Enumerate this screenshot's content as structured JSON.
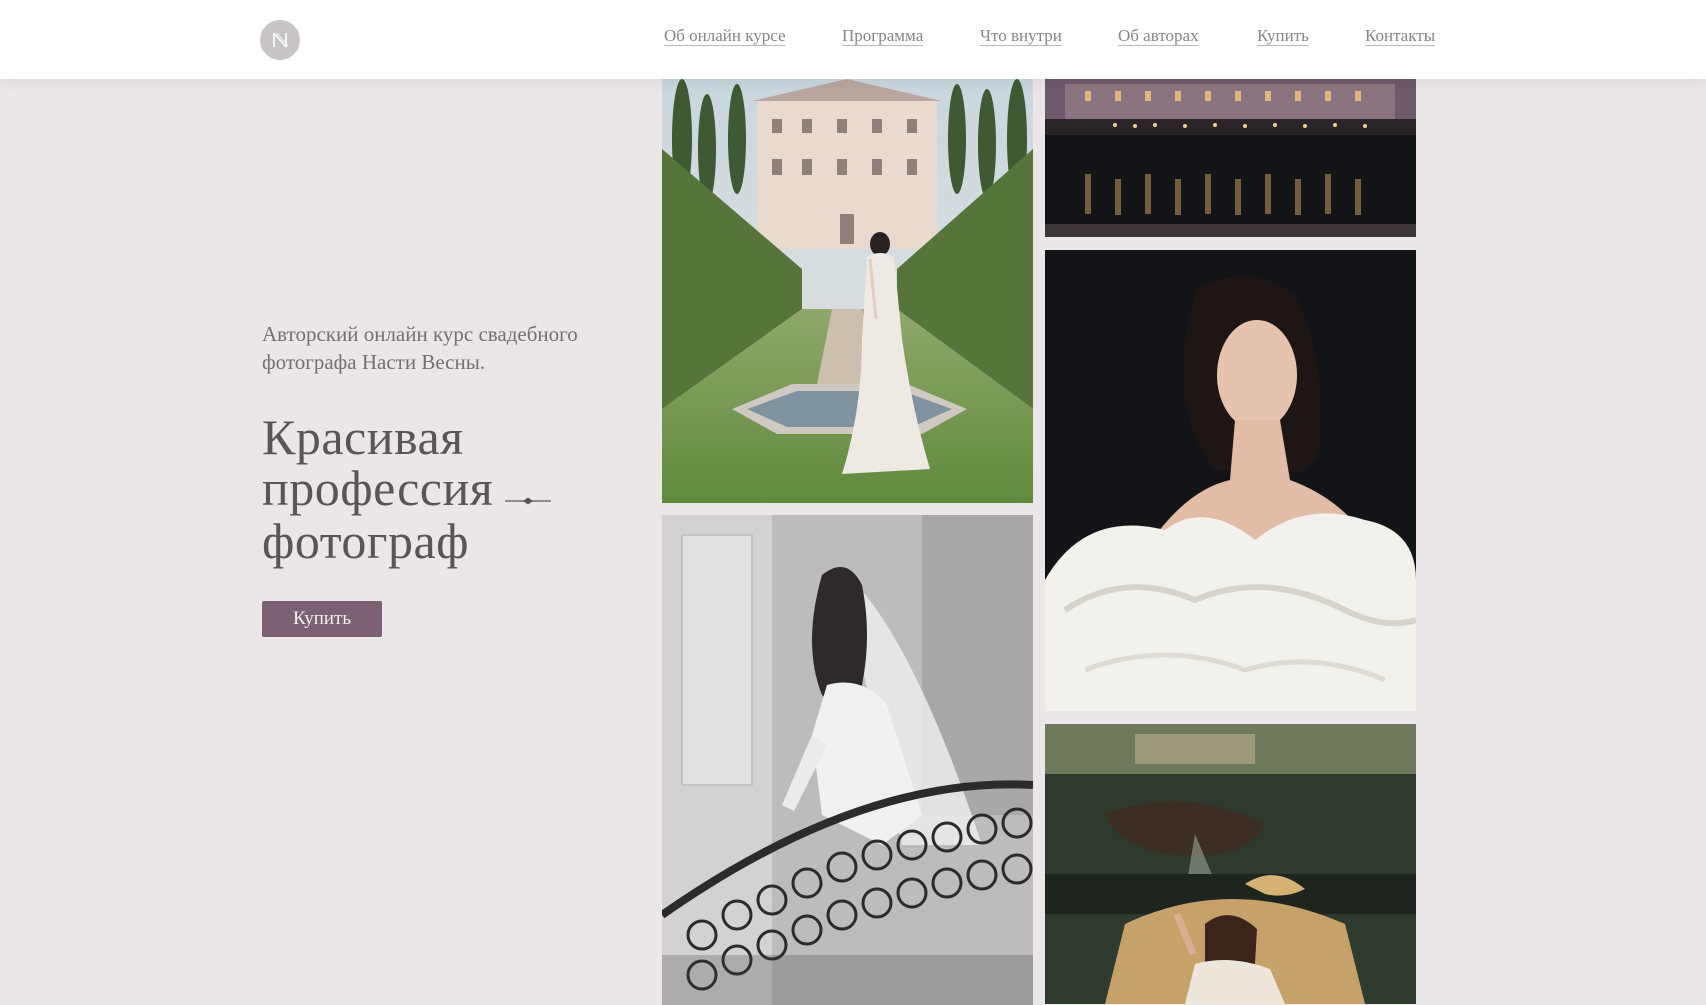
{
  "header": {
    "logo_icon": "monogram-n-logo",
    "nav": [
      {
        "label": "Об онлайн курсе"
      },
      {
        "label": "Программа"
      },
      {
        "label": "Что внутри"
      },
      {
        "label": "Об авторах"
      },
      {
        "label": "Купить"
      },
      {
        "label": "Контакты"
      }
    ]
  },
  "hero": {
    "subtitle": "Авторский онлайн курс свадебного фотографа Насти Весны.",
    "headline_lines": [
      "Красивая",
      "профессия",
      "фотограф"
    ],
    "decor_icon": "arrow-dash-icon",
    "buy_button": "Купить"
  },
  "colors": {
    "background": "#ebe6e7",
    "header_bg": "#ffffff",
    "accent": "#7b6171",
    "text": "#5a5556"
  },
  "gallery": [
    {
      "icon": "photo-bride-villa-garden"
    },
    {
      "icon": "photo-bride-staircase-bw"
    },
    {
      "icon": "photo-villa-night-reflection"
    },
    {
      "icon": "photo-portrait-white-dress"
    },
    {
      "icon": "photo-woman-painting-backdrop"
    }
  ]
}
